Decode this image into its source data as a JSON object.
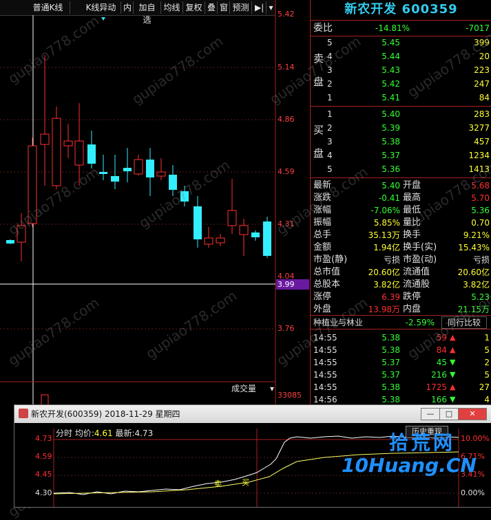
{
  "toolbar": {
    "items": [
      "普通K线",
      "K线异动",
      "内",
      "加自选",
      "均线",
      "复权",
      "叠",
      "窗",
      "预测"
    ]
  },
  "chart": {
    "price_labels": [
      "5.42",
      "5.14",
      "4.86",
      "4.59",
      "4.31",
      "4.04",
      "3.99",
      "3.76"
    ],
    "volume_dropdown": "成交量",
    "volume_value": "33085"
  },
  "quote": {
    "title": "新农开发 600359",
    "weibi": {
      "label": "委比",
      "pct": "-14.81%",
      "value": "-7017"
    },
    "sell_label": [
      "卖",
      "盘"
    ],
    "buy_label": [
      "买",
      "盘"
    ],
    "sell": [
      {
        "level": "5",
        "price": "5.45",
        "vol": "399"
      },
      {
        "level": "4",
        "price": "5.44",
        "vol": "20"
      },
      {
        "level": "3",
        "price": "5.43",
        "vol": "223"
      },
      {
        "level": "2",
        "price": "5.42",
        "vol": "247"
      },
      {
        "level": "1",
        "price": "5.41",
        "vol": "84"
      }
    ],
    "buy": [
      {
        "level": "1",
        "price": "5.40",
        "vol": "283"
      },
      {
        "level": "2",
        "price": "5.39",
        "vol": "3277"
      },
      {
        "level": "3",
        "price": "5.38",
        "vol": "457"
      },
      {
        "level": "4",
        "price": "5.37",
        "vol": "1234"
      },
      {
        "level": "5",
        "price": "5.36",
        "vol": "1413"
      }
    ],
    "stats": [
      {
        "l1": "最新",
        "v1": "5.40",
        "c1": "green",
        "l2": "开盘",
        "v2": "5.68",
        "c2": "red"
      },
      {
        "l1": "涨跌",
        "v1": "-0.41",
        "c1": "green",
        "l2": "最高",
        "v2": "5.70",
        "c2": "red"
      },
      {
        "l1": "涨幅",
        "v1": "-7.06%",
        "c1": "green",
        "l2": "最低",
        "v2": "5.36",
        "c2": "green"
      },
      {
        "l1": "振幅",
        "v1": "5.85%",
        "c1": "yellow",
        "l2": "量比",
        "v2": "0.70",
        "c2": "yellow"
      },
      {
        "l1": "总手",
        "v1": "35.13万",
        "c1": "yellow",
        "l2": "换手",
        "v2": "9.21%",
        "c2": "yellow"
      },
      {
        "l1": "金额",
        "v1": "1.94亿",
        "c1": "yellow",
        "l2": "换手(实)",
        "v2": "15.43%",
        "c2": "yellow"
      },
      {
        "l1": "市盈(静)",
        "v1": "亏损",
        "c1": "white",
        "l2": "市盈(动)",
        "v2": "亏损",
        "c2": "white"
      },
      {
        "l1": "总市值",
        "v1": "20.60亿",
        "c1": "yellow",
        "l2": "流通值",
        "v2": "20.60亿",
        "c2": "yellow"
      },
      {
        "l1": "总股本",
        "v1": "3.82亿",
        "c1": "yellow",
        "l2": "流通股",
        "v2": "3.82亿",
        "c2": "yellow"
      },
      {
        "l1": "涨停",
        "v1": "6.39",
        "c1": "red",
        "l2": "跌停",
        "v2": "5.23",
        "c2": "green"
      },
      {
        "l1": "外盘",
        "v1": "13.98万",
        "c1": "red",
        "l2": "内盘",
        "v2": "21.15万",
        "c2": "green"
      }
    ],
    "industry": {
      "name": "种植业与林业",
      "pct": "-2.59%",
      "button": "同行比较"
    },
    "ticks": [
      {
        "time": "14:55",
        "price": "5.38",
        "vol": "59",
        "dir": "up",
        "extra": "1"
      },
      {
        "time": "14:55",
        "price": "5.38",
        "vol": "84",
        "dir": "up",
        "extra": "5"
      },
      {
        "time": "14:55",
        "price": "5.37",
        "vol": "45",
        "dir": "down",
        "extra": "2"
      },
      {
        "time": "14:55",
        "price": "5.37",
        "vol": "216",
        "dir": "down",
        "extra": "5"
      },
      {
        "time": "14:55",
        "price": "5.38",
        "vol": "1725",
        "dir": "up",
        "extra": "27"
      },
      {
        "time": "14:56",
        "price": "5.38",
        "vol": "166",
        "dir": "down",
        "extra": "4"
      }
    ]
  },
  "popup": {
    "title": "新农开发(600359) 2018-11-29 星期四",
    "legend_fen": "分时",
    "legend_avg_label": "均价:",
    "legend_avg": "4.61",
    "legend_last_label": "最新:",
    "legend_last": "4.73",
    "history_button": "历史重现",
    "y_labels": [
      "4.73",
      "4.59",
      "4.45",
      "4.30"
    ],
    "pct_labels": [
      "10.00%",
      "6.71%",
      "3.41%",
      "0.00%"
    ],
    "marker_buy": "买",
    "marker_sell": "卖"
  },
  "watermark": "gupiao778.com",
  "logo": {
    "text": "拾荒网",
    "domain": "10Huang.CN"
  }
}
